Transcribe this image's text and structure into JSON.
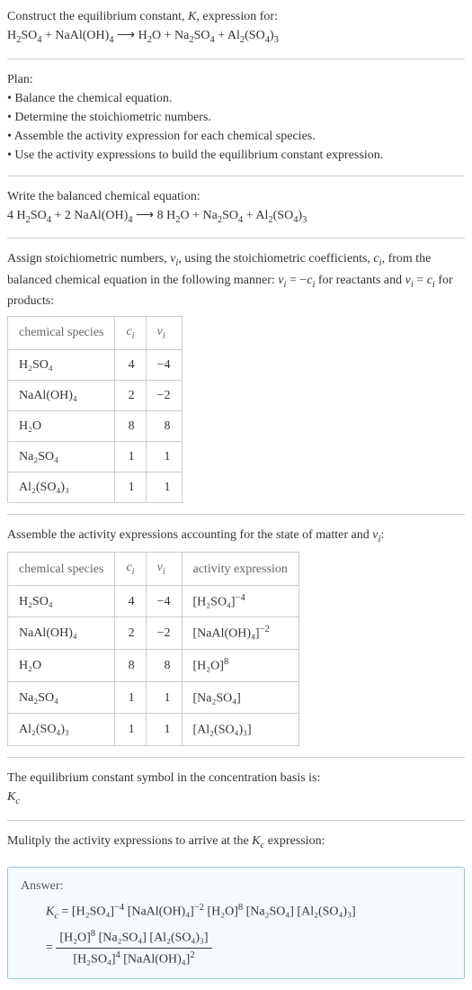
{
  "intro": {
    "title_prefix": "Construct the equilibrium constant, ",
    "title_k": "K",
    "title_suffix": ", expression for:",
    "equation_lhs_1": "H",
    "equation_lhs_1_sub": "2",
    "equation_lhs_2": "SO",
    "equation_lhs_2_sub": "4",
    "plus1": " + NaAl(OH)",
    "plus1_sub": "4",
    "arrow": " ⟶ ",
    "rhs_1": "H",
    "rhs_1_sub": "2",
    "rhs_2": "O + Na",
    "rhs_2_sub": "2",
    "rhs_3": "SO",
    "rhs_3_sub": "4",
    "rhs_4": " + Al",
    "rhs_4_sub": "2",
    "rhs_5": "(SO",
    "rhs_5_sub": "4",
    "rhs_6": ")",
    "rhs_6_sub": "3"
  },
  "plan": {
    "title": "Plan:",
    "b1": "• Balance the chemical equation.",
    "b2": "• Determine the stoichiometric numbers.",
    "b3": "• Assemble the activity expression for each chemical species.",
    "b4": "• Use the activity expressions to build the equilibrium constant expression."
  },
  "balanced": {
    "title": "Write the balanced chemical equation:",
    "c1": "4 H",
    "c1_sub": "2",
    "c2": "SO",
    "c2_sub": "4",
    "c3": " + 2 NaAl(OH)",
    "c3_sub": "4",
    "arrow": " ⟶ ",
    "c4": "8 H",
    "c4_sub": "2",
    "c5": "O + Na",
    "c5_sub": "2",
    "c6": "SO",
    "c6_sub": "4",
    "c7": " + Al",
    "c7_sub": "2",
    "c8": "(SO",
    "c8_sub": "4",
    "c9": ")",
    "c9_sub": "3"
  },
  "stoich": {
    "text1": "Assign stoichiometric numbers, ",
    "nu": "ν",
    "nu_sub": "i",
    "text2": ", using the stoichiometric coefficients, ",
    "ci": "c",
    "ci_sub": "i",
    "text3": ", from the balanced chemical equation in the following manner: ",
    "eq1": "ν",
    "eq1_sub": "i",
    "eq2": " = −",
    "eq3": "c",
    "eq3_sub": "i",
    "text4": " for reactants and ",
    "eq4": "ν",
    "eq4_sub": "i",
    "eq5": " = ",
    "eq6": "c",
    "eq6_sub": "i",
    "text5": " for products:"
  },
  "table1": {
    "h1": "chemical species",
    "h2": "c",
    "h2_sub": "i",
    "h3": "ν",
    "h3_sub": "i",
    "rows": [
      {
        "sp": "H₂SO₄",
        "c": "4",
        "nu": "−4"
      },
      {
        "sp": "NaAl(OH)₄",
        "c": "2",
        "nu": "−2"
      },
      {
        "sp": "H₂O",
        "c": "8",
        "nu": "8"
      },
      {
        "sp": "Na₂SO₄",
        "c": "1",
        "nu": "1"
      },
      {
        "sp": "Al₂(SO₄)₃",
        "c": "1",
        "nu": "1"
      }
    ]
  },
  "assemble": {
    "text1": "Assemble the activity expressions accounting for the state of matter and ",
    "nu": "ν",
    "nu_sub": "i",
    "text2": ":"
  },
  "table2": {
    "h1": "chemical species",
    "h2": "c",
    "h2_sub": "i",
    "h3": "ν",
    "h3_sub": "i",
    "h4": "activity expression",
    "rows": [
      {
        "sp": "H₂SO₄",
        "c": "4",
        "nu": "−4",
        "ae_base": "[H₂SO₄]",
        "ae_exp": "−4"
      },
      {
        "sp": "NaAl(OH)₄",
        "c": "2",
        "nu": "−2",
        "ae_base": "[NaAl(OH)₄]",
        "ae_exp": "−2"
      },
      {
        "sp": "H₂O",
        "c": "8",
        "nu": "8",
        "ae_base": "[H₂O]",
        "ae_exp": "8"
      },
      {
        "sp": "Na₂SO₄",
        "c": "1",
        "nu": "1",
        "ae_base": "[Na₂SO₄]",
        "ae_exp": ""
      },
      {
        "sp": "Al₂(SO₄)₃",
        "c": "1",
        "nu": "1",
        "ae_base": "[Al₂(SO₄)₃]",
        "ae_exp": ""
      }
    ]
  },
  "eqconst": {
    "line1": "The equilibrium constant symbol in the concentration basis is:",
    "kc": "K",
    "kc_sub": "c"
  },
  "multiply": {
    "text1": "Mulitply the activity expressions to arrive at the ",
    "kc": "K",
    "kc_sub": "c",
    "text2": " expression:"
  },
  "answer": {
    "label": "Answer:",
    "kc": "K",
    "kc_sub": "c",
    "eq": " = ",
    "t1": "[H₂SO₄]",
    "t1_exp": "−4",
    "sp1": " ",
    "t2": "[NaAl(OH)₄]",
    "t2_exp": "−2",
    "sp2": " ",
    "t3": "[H₂O]",
    "t3_exp": "8",
    "sp3": " ",
    "t4": "[Na₂SO₄] [Al₂(SO₄)₃]",
    "eq2": "= ",
    "num1": "[H₂O]",
    "num1_exp": "8",
    "num2": " [Na₂SO₄] [Al₂(SO₄)₃]",
    "den1": "[H₂SO₄]",
    "den1_exp": "4",
    "den2": " [NaAl(OH)₄]",
    "den2_exp": "2"
  }
}
